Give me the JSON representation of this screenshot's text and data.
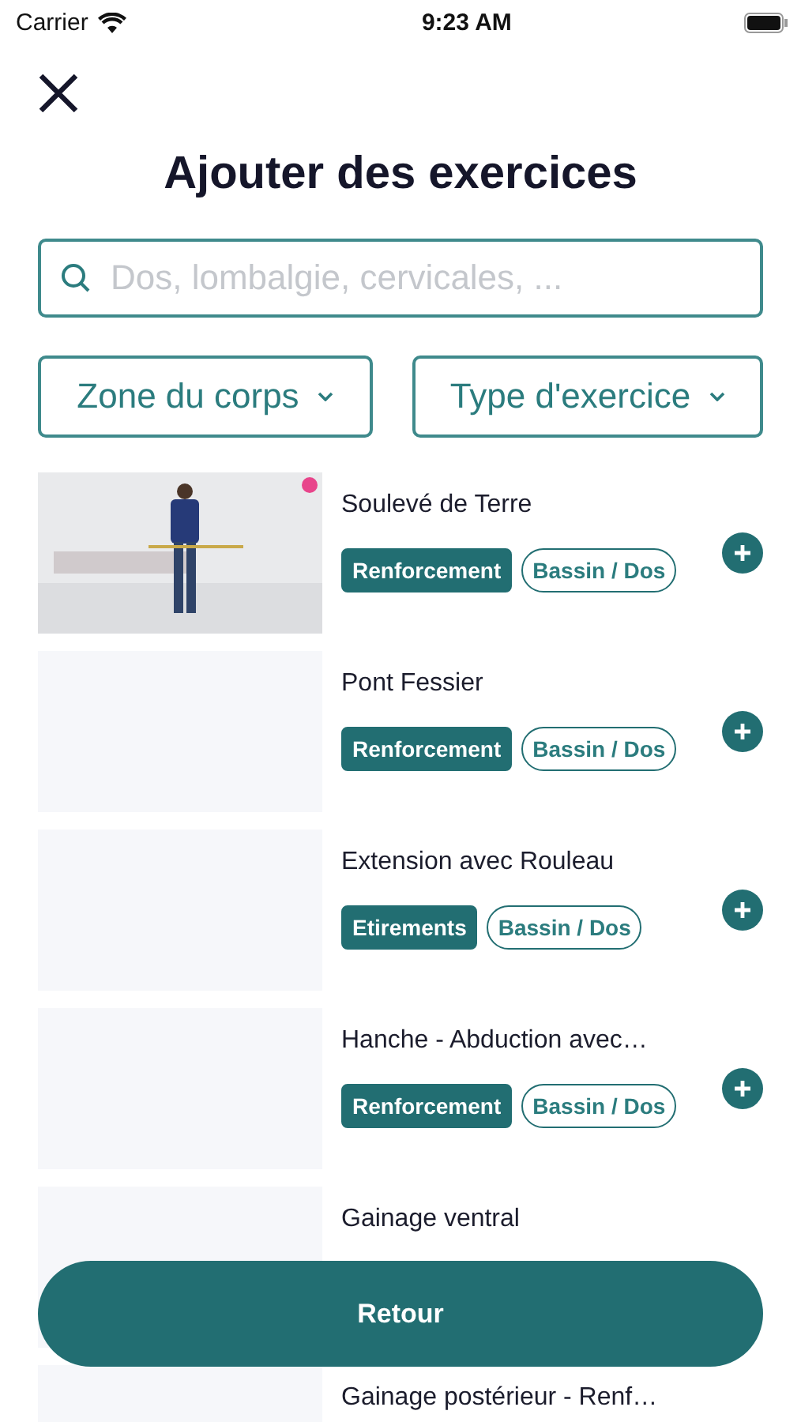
{
  "status_bar": {
    "carrier": "Carrier",
    "time": "9:23 AM"
  },
  "title": "Ajouter des exercices",
  "search": {
    "placeholder": "Dos, lombalgie, cervicales, ..."
  },
  "filters": [
    {
      "label": "Zone du corps"
    },
    {
      "label": "Type d'exercice"
    }
  ],
  "exercises": [
    {
      "title": "Soulevé de Terre",
      "tags": [
        {
          "label": "Renforcement",
          "kind": "filled"
        },
        {
          "label": "Bassin / Dos",
          "kind": "outline"
        }
      ],
      "add_button": true
    },
    {
      "thumbnail": {
        "kind": "blank"
      },
      "title": "Pont Fessier",
      "tags": [
        {
          "label": "Renforcement",
          "kind": "filled"
        },
        {
          "label": "Bassin / Dos",
          "kind": "outline"
        }
      ],
      "add_button": true
    },
    {
      "thumbnail": {
        "kind": "blank"
      },
      "title": "Extension avec Rouleau",
      "tags": [
        {
          "label": "Etirements",
          "kind": "filled"
        },
        {
          "label": "Bassin / Dos",
          "kind": "outline"
        }
      ],
      "add_button": true
    },
    {
      "thumbnail": {
        "kind": "blank"
      },
      "title": "Hanche - Abduction avec…",
      "tags": [
        {
          "label": "Renforcement",
          "kind": "filled"
        },
        {
          "label": "Bassin / Dos",
          "kind": "outline"
        }
      ],
      "add_button": true
    },
    {
      "thumbnail": {
        "kind": "blank"
      },
      "title": "Gainage ventral"
    },
    {
      "thumbnail": {
        "kind": "blank"
      },
      "title": "Gainage postérieur - Renf…"
    }
  ],
  "back_button": {
    "label": "Retour"
  }
}
